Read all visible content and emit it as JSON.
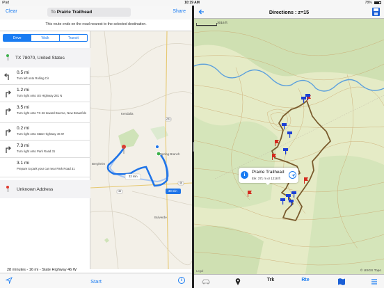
{
  "status_bar": {
    "device": "iPad",
    "time": "10:19 AM",
    "battery": "78%"
  },
  "left_nav": {
    "clear": "Clear",
    "dest_prefix": "To",
    "dest_name": "Prairie Trailhead",
    "share": "Share"
  },
  "route_note": "This route ends on the road nearest to the selected destination.",
  "transport_modes": [
    {
      "label": "Drive",
      "active": true
    },
    {
      "label": "Walk",
      "active": false
    },
    {
      "label": "Transit",
      "active": false
    }
  ],
  "start_location": "TX  78070, United States",
  "steps": [
    {
      "distance": "0.5 mi",
      "instruction": "Turn left onto Rolling Cir",
      "icon": "turn-left-icon"
    },
    {
      "distance": "1.2 mi",
      "instruction": "Turn right onto US Highway 281 N",
      "icon": "turn-right-icon"
    },
    {
      "distance": "3.5 mi",
      "instruction": "Turn right onto TX-46 toward Boerne, New Braunfels",
      "icon": "turn-right-icon"
    },
    {
      "distance": "0.2 mi",
      "instruction": "Turn right onto State Highway 46 W",
      "icon": "turn-right-icon"
    },
    {
      "distance": "7.3 mi",
      "instruction": "Turn right onto Park Road 31",
      "icon": "turn-right-icon"
    },
    {
      "distance": "3.1 mi",
      "instruction": "Prepare to park your car near Park Road 31",
      "icon": "arrive-icon"
    }
  ],
  "end_location": "Unknown Address",
  "summary": "28 minutes - 16 mi - State Highway 46 W",
  "left_tab": {
    "start": "Start",
    "info": "i"
  },
  "apple_map": {
    "places": [
      "Kendalia",
      "Spring Branch",
      "Bergheim",
      "Bulverde"
    ],
    "route_labels": [
      "32 min",
      "38 min"
    ],
    "road_shields": [
      "281",
      "46",
      "46"
    ]
  },
  "right_nav": {
    "title": "Directions : z=15"
  },
  "topo": {
    "scale": "3016 ft",
    "attribution": "© USGS Topo",
    "legal": "Legal",
    "popup_name": "Prairie Trailhead",
    "popup_elev": "Ele: 371 m or 1218 ft"
  },
  "right_tab": [
    "Trk",
    "Rte"
  ],
  "colors": {
    "accent": "#1a7cf2",
    "route": "#7a5c2e",
    "waypoint": "#d42a1e",
    "marker": "#1b3fd6"
  }
}
